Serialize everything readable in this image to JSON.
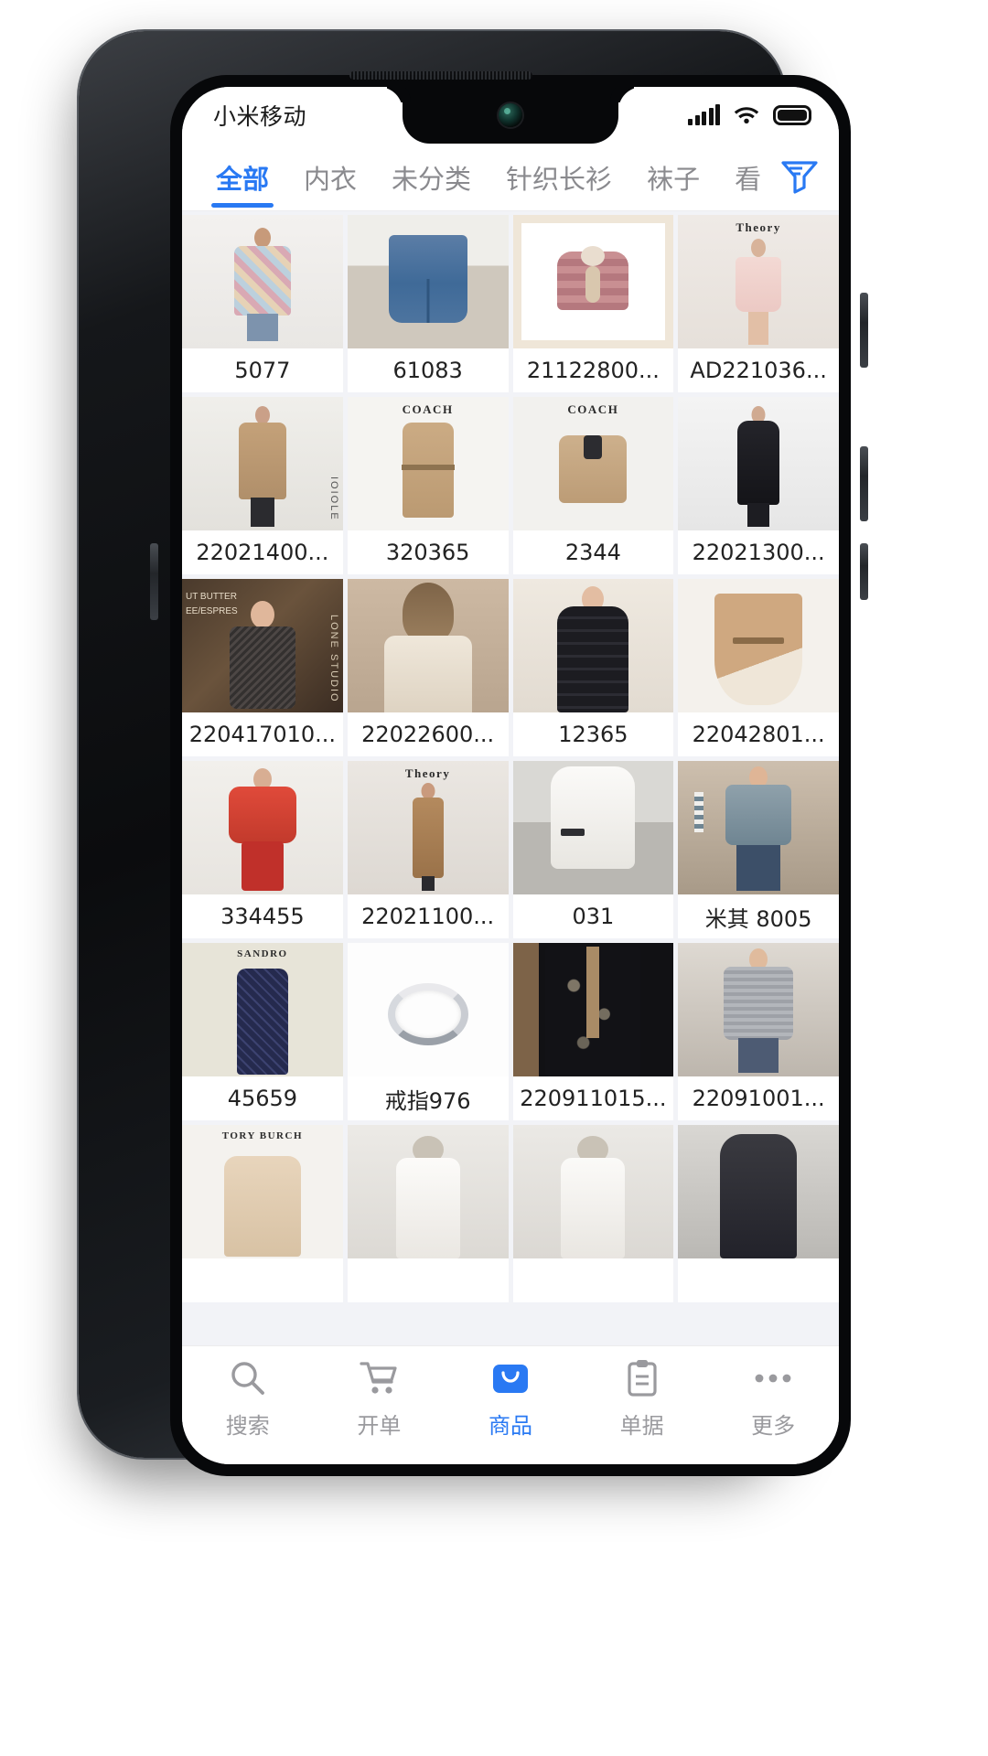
{
  "status_bar": {
    "carrier": "小米移动",
    "icons": [
      "signal-bars-icon",
      "wifi-icon",
      "battery-icon"
    ]
  },
  "tab_strip": {
    "tabs": [
      {
        "label": "全部",
        "active": true
      },
      {
        "label": "内衣",
        "active": false
      },
      {
        "label": "未分类",
        "active": false
      },
      {
        "label": "针织长衫",
        "active": false
      },
      {
        "label": "袜子",
        "active": false
      },
      {
        "label": "看",
        "active": false
      }
    ],
    "filter_icon": "filter-funnel-icon",
    "accent_color": "#2979f3"
  },
  "product_grid": {
    "columns": 4,
    "items": [
      {
        "name": "5077",
        "thumb": "plaid-coat-model"
      },
      {
        "name": "61083",
        "thumb": "denim-shorts-model"
      },
      {
        "name": "21122800...",
        "thumb": "kids-pink-fleece-jacket"
      },
      {
        "name": "AD221036...",
        "thumb": "theory-blush-dress",
        "brand": "Theory"
      },
      {
        "name": "22021400...",
        "thumb": "camel-trench-model",
        "side_text": "IOIOLE"
      },
      {
        "name": "320365",
        "thumb": "coach-belted-trench",
        "brand": "COACH"
      },
      {
        "name": "2344",
        "thumb": "coach-short-trench",
        "brand": "COACH"
      },
      {
        "name": "22021300...",
        "thumb": "black-long-puffer-model"
      },
      {
        "name": "220417010...",
        "thumb": "sequin-puff-sleeve-top",
        "side_text": "LONE STUDIO"
      },
      {
        "name": "22022600...",
        "thumb": "cream-hoodie-back"
      },
      {
        "name": "12365",
        "thumb": "black-hooded-puffer"
      },
      {
        "name": "22042801...",
        "thumb": "camel-cape-belted"
      },
      {
        "name": "334455",
        "thumb": "red-puffer-jacket-model"
      },
      {
        "name": "22021100...",
        "thumb": "theory-camel-knit-dress",
        "brand": "Theory"
      },
      {
        "name": "031",
        "thumb": "white-long-parka"
      },
      {
        "name": "米其 8005",
        "thumb": "denim-jacket-stripe-sleeve"
      },
      {
        "name": "45659",
        "thumb": "sandro-navy-print-dress",
        "brand": "SANDRO"
      },
      {
        "name": "戒指976",
        "thumb": "silver-ring"
      },
      {
        "name": "220911015...",
        "thumb": "black-embroidered-jacket"
      },
      {
        "name": "22091001...",
        "thumb": "grey-knit-cardigan-model"
      },
      {
        "name": "",
        "thumb": "tory-burch-beige-fleece",
        "brand": "TORY BURCH"
      },
      {
        "name": "",
        "thumb": "white-fur-hood-parka-1"
      },
      {
        "name": "",
        "thumb": "white-fur-hood-parka-2"
      },
      {
        "name": "",
        "thumb": "dark-grey-hooded-puffer"
      }
    ]
  },
  "bottom_nav": {
    "items": [
      {
        "label": "搜索",
        "icon": "search-icon",
        "active": false
      },
      {
        "label": "开单",
        "icon": "cart-icon",
        "active": false
      },
      {
        "label": "商品",
        "icon": "bag-icon",
        "active": true
      },
      {
        "label": "单据",
        "icon": "clipboard-icon",
        "active": false
      },
      {
        "label": "更多",
        "icon": "ellipsis-icon",
        "active": false
      }
    ],
    "active_color": "#2979f3",
    "inactive_color": "#9a9a9e"
  }
}
